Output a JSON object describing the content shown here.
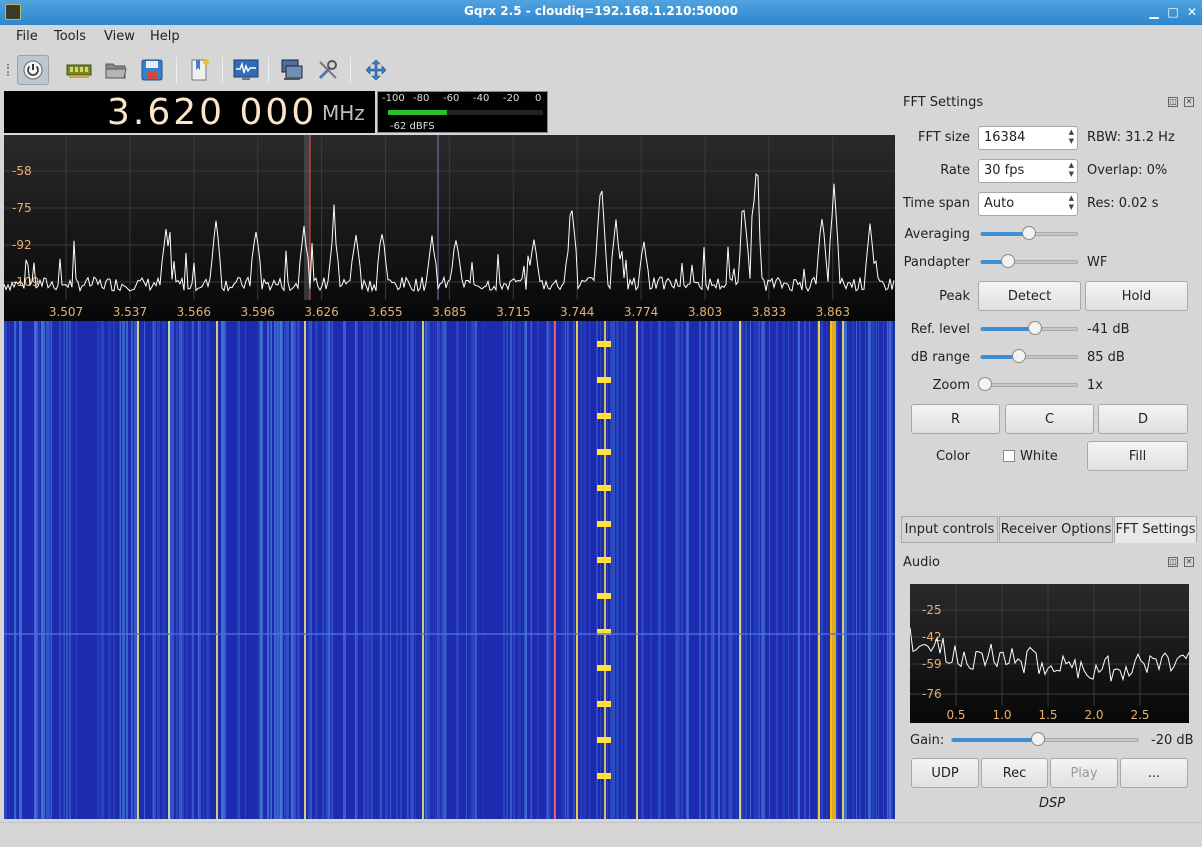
{
  "window": {
    "title": "Gqrx 2.5 - cloudiq=192.168.1.210:50000",
    "min_glyph": "▁",
    "max_glyph": "□",
    "close_glyph": "✕"
  },
  "menu": [
    "File",
    "Tools",
    "View",
    "Help"
  ],
  "toolbar": {
    "icons": [
      "power-icon",
      "hardware-icon",
      "folder-open-icon",
      "save-icon",
      "bookmark-icon",
      "waveform-icon",
      "remote-control-icon",
      "tools-icon",
      "fullscreen-icon"
    ]
  },
  "frequency": {
    "value": "3.620 000",
    "unit": "MHz"
  },
  "signal_meter": {
    "ticks": [
      "-100",
      "-80",
      "-60",
      "-40",
      "-20",
      "0"
    ],
    "level_dbfs": -62,
    "value_label": "-62 dBFS"
  },
  "chart_data": [
    {
      "type": "line",
      "series": [],
      "x_ticks": [
        "3.507",
        "3.537",
        "3.566",
        "3.596",
        "3.626",
        "3.655",
        "3.685",
        "3.715",
        "3.744",
        "3.774",
        "3.803",
        "3.833",
        "3.863"
      ],
      "y_ticks": [
        "-58",
        "-75",
        "-92",
        "-109"
      ],
      "grid": true,
      "colors": {
        "trace": "#ffffff",
        "tick_label": "#e6b073",
        "marker_red": "#ff4a4a"
      }
    },
    {
      "type": "line",
      "series": [],
      "x_ticks": [
        "0.5",
        "1.0",
        "1.5",
        "2.0",
        "2.5"
      ],
      "y_ticks": [
        "-25",
        "-42",
        "-59",
        "-76"
      ],
      "grid": true,
      "colors": {
        "trace": "#ffffff",
        "tick_label": "#e6b073"
      }
    }
  ],
  "fft_panel": {
    "title": "FFT Settings",
    "fft_size": {
      "label": "FFT size",
      "value": "16384",
      "info": "RBW: 31.2 Hz"
    },
    "rate": {
      "label": "Rate",
      "value": "30 fps",
      "info": "Overlap: 0%"
    },
    "time_span": {
      "label": "Time span",
      "value": "Auto",
      "info": "Res: 0.02 s"
    },
    "averaging": {
      "label": "Averaging",
      "level": 0.5
    },
    "pandapter": {
      "label": "Pandapter",
      "level": 0.28,
      "info": "WF"
    },
    "peak": {
      "label": "Peak",
      "detect": "Detect",
      "hold": "Hold"
    },
    "ref_level": {
      "label": "Ref. level",
      "level": 0.56,
      "info": "-41 dB"
    },
    "db_range": {
      "label": "dB range",
      "level": 0.4,
      "info": "85 dB"
    },
    "zoom": {
      "label": "Zoom",
      "level": 0.0,
      "info": "1x"
    },
    "buttons": [
      "R",
      "C",
      "D"
    ],
    "color": {
      "label": "Color",
      "checkbox_label": "White",
      "fill": "Fill"
    }
  },
  "tabs": [
    "Input controls",
    "Receiver Options",
    "FFT Settings"
  ],
  "audio_panel": {
    "title": "Audio",
    "gain": {
      "label": "Gain:",
      "level": 0.46,
      "info": "-20 dB"
    },
    "buttons": [
      "UDP",
      "Rec",
      "Play",
      "..."
    ],
    "dsp_label": "DSP"
  }
}
